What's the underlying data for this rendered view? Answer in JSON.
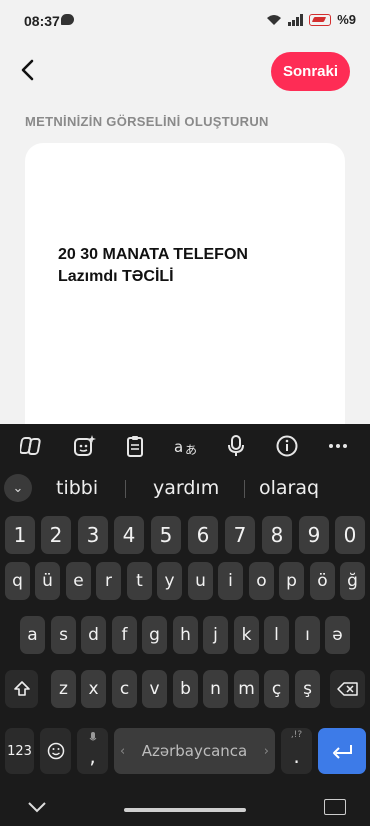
{
  "status": {
    "time": "08:37",
    "battery": "%9"
  },
  "header": {
    "next_label": "Sonraki"
  },
  "section_title": "METNİNİZİN GÖRSELİNİ OLUŞTURUN",
  "card": {
    "line1": "20 30 MANATA TELEFON",
    "line2": "Lazımdı TƏCİLİ"
  },
  "keyboard": {
    "suggestions": [
      "tibbi",
      "yardım",
      "olaraq"
    ],
    "row_numbers": [
      "1",
      "2",
      "3",
      "4",
      "5",
      "6",
      "7",
      "8",
      "9",
      "0"
    ],
    "row1": [
      "q",
      "ü",
      "e",
      "r",
      "t",
      "y",
      "u",
      "i",
      "o",
      "p",
      "ö",
      "ğ"
    ],
    "row2": [
      "a",
      "s",
      "d",
      "f",
      "g",
      "h",
      "j",
      "k",
      "l",
      "ı",
      "ə"
    ],
    "row3": [
      "z",
      "x",
      "c",
      "v",
      "b",
      "n",
      "m",
      "ç",
      "ş"
    ],
    "symbols_label": "123",
    "comma_label": ",",
    "space_label": "Azərbaycanca",
    "period_label": ".",
    "period_hint": ",!?"
  }
}
